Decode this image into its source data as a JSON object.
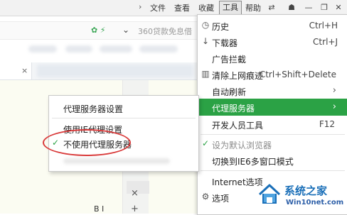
{
  "menubar": {
    "items": [
      "文件",
      "查看",
      "收藏",
      "工具",
      "帮助"
    ],
    "active": "工具"
  },
  "addressbar": {
    "search_text": "360贷款免息借"
  },
  "main_menu": {
    "items": [
      {
        "icon": "history-icon",
        "label": "历史",
        "shortcut": "Ctrl+H"
      },
      {
        "icon": "download-icon",
        "label": "下载器",
        "shortcut": "Ctrl+J"
      },
      {
        "icon": "",
        "label": "广告拦截",
        "shortcut": ""
      },
      {
        "icon": "trash-icon",
        "label": "清除上网痕迹",
        "shortcut": "Ctrl+Shift+Delete"
      },
      {
        "icon": "",
        "label": "自动刷新",
        "shortcut": ""
      },
      {
        "icon": "",
        "label": "代理服务器",
        "shortcut": ""
      },
      {
        "icon": "",
        "label": "开发人员工具",
        "shortcut": "F12"
      },
      {
        "icon": "check-icon",
        "label": "设为默认浏览器",
        "shortcut": ""
      },
      {
        "icon": "",
        "label": "切换到IE6多窗口模式",
        "shortcut": ""
      },
      {
        "icon": "",
        "label": "Internet选项",
        "shortcut": ""
      },
      {
        "icon": "gear-icon",
        "label": "选项",
        "shortcut": ""
      }
    ],
    "highlighted": "代理服务器"
  },
  "proxy_submenu": {
    "items": [
      {
        "label": "代理服务器设置",
        "checked": false
      },
      {
        "label": "使用IE代理设置",
        "checked": false
      },
      {
        "label": "不使用代理服务器",
        "checked": true
      }
    ]
  },
  "page": {
    "bi_text": "B  I"
  },
  "watermark": {
    "title": "系统之家",
    "subtitle": "Win10net.com"
  },
  "colors": {
    "highlight": "#2ba245",
    "annotation": "#d93a3a"
  }
}
